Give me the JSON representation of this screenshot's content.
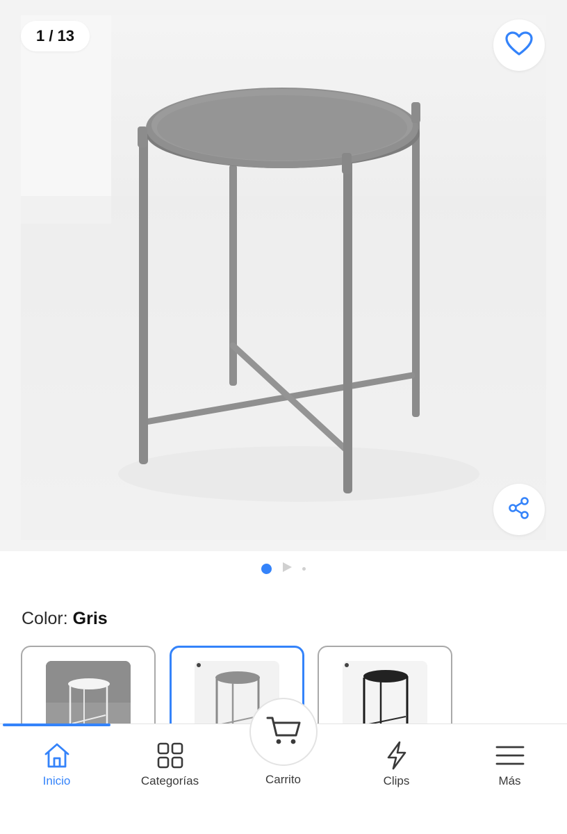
{
  "gallery": {
    "counter": "1 / 13",
    "favorite_icon": "heart-icon",
    "share_icon": "share-icon",
    "pager": {
      "active_index": 0,
      "has_video": true
    }
  },
  "product": {
    "color_label": "Color:",
    "color_value": "Gris",
    "swatches": [
      {
        "name": "Blanco",
        "selected": false
      },
      {
        "name": "Gris",
        "selected": true
      },
      {
        "name": "Negro",
        "selected": false
      }
    ]
  },
  "nav": {
    "accent": "#3483fa",
    "items": [
      {
        "label": "Inicio",
        "icon": "home-icon",
        "active": true
      },
      {
        "label": "Categorías",
        "icon": "grid-icon",
        "active": false
      },
      {
        "label": "Carrito",
        "icon": "cart-icon",
        "active": false
      },
      {
        "label": "Clips",
        "icon": "lightning-icon",
        "active": false
      },
      {
        "label": "Más",
        "icon": "menu-icon",
        "active": false
      }
    ]
  }
}
